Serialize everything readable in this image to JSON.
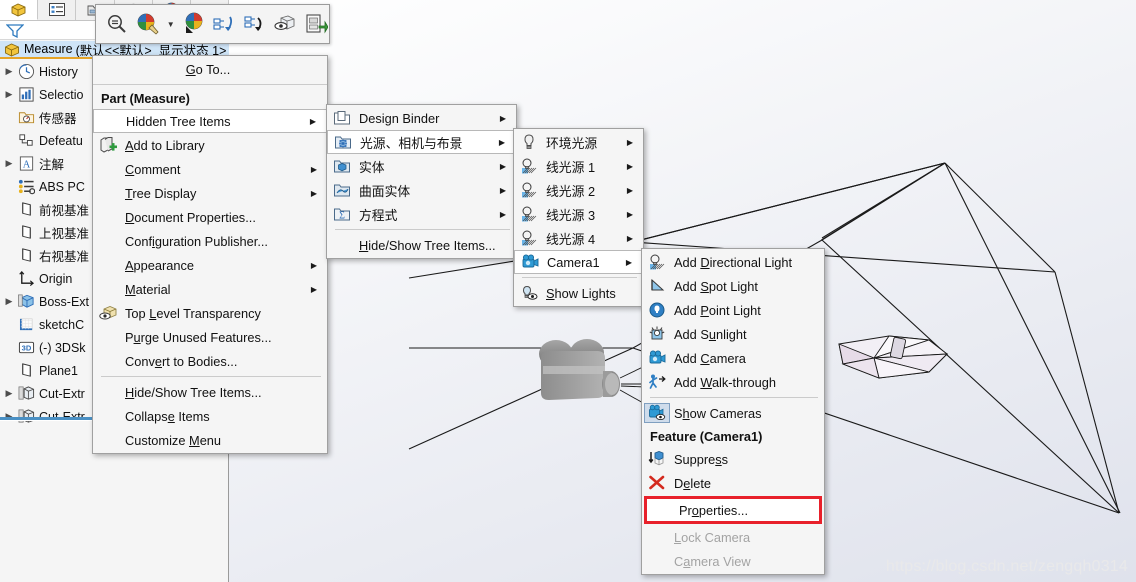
{
  "panel": {
    "tabs": [
      {
        "name": "feature-manager-tab",
        "icon": "yellow-box-icon"
      },
      {
        "name": "property-manager-tab",
        "icon": "list-icon"
      },
      {
        "name": "configuration-manager-tab",
        "icon": "config-icon"
      },
      {
        "name": "dimxpert-manager-tab",
        "icon": "globe-icon"
      },
      {
        "name": "display-manager-tab",
        "icon": "palette-icon"
      },
      {
        "name": "more-tab",
        "icon": "arrow-icon"
      }
    ],
    "filter_placeholder": "",
    "document": {
      "name": "Measure",
      "config": "(默认<<默认>_显示状态 1>"
    },
    "tree": [
      {
        "arrow": true,
        "icon": "history-icon",
        "label": "History"
      },
      {
        "arrow": true,
        "icon": "selection-sets-icon",
        "label": "Selectio"
      },
      {
        "arrow": false,
        "icon": "sensors-icon",
        "label": "传感器"
      },
      {
        "arrow": false,
        "icon": "defeature-icon",
        "label": "Defeatu"
      },
      {
        "arrow": true,
        "icon": "annotations-icon",
        "label": "注解"
      },
      {
        "arrow": false,
        "icon": "material-icon",
        "label": "ABS PC"
      },
      {
        "arrow": false,
        "icon": "plane-icon",
        "label": "前视基准"
      },
      {
        "arrow": false,
        "icon": "plane-icon",
        "label": "上视基准"
      },
      {
        "arrow": false,
        "icon": "plane-icon",
        "label": "右视基准"
      },
      {
        "arrow": false,
        "icon": "origin-icon",
        "label": "Origin"
      },
      {
        "arrow": true,
        "icon": "boss-extrude-icon",
        "label": "Boss-Ext"
      },
      {
        "arrow": false,
        "icon": "sketch-icon",
        "label": "sketchC"
      },
      {
        "arrow": false,
        "icon": "3dsketch-icon",
        "label": "(-) 3DSk"
      },
      {
        "arrow": false,
        "icon": "plane-icon",
        "label": "Plane1"
      },
      {
        "arrow": true,
        "icon": "cut-extrude-icon",
        "label": "Cut-Extr"
      },
      {
        "arrow": true,
        "icon": "cut-extrude-icon",
        "label": "Cut-Extr"
      }
    ]
  },
  "context_toolbar": {
    "buttons": [
      {
        "name": "zoom-to-selection-button",
        "icon": "magnifier-icon"
      },
      {
        "name": "appearance-button",
        "icon": "paint-sphere-icon"
      },
      {
        "name": "appearance-dropdown",
        "icon": "chevron-down-icon"
      },
      {
        "name": "change-transparency-button",
        "icon": "sphere-arrow-icon"
      },
      {
        "name": "rollback-button",
        "icon": "rollback-icon"
      },
      {
        "name": "parent-child-button",
        "icon": "parent-child-icon"
      },
      {
        "name": "hide-show-button",
        "icon": "eye-box-icon"
      },
      {
        "name": "open-document-button",
        "icon": "open-doc-icon"
      }
    ]
  },
  "menu_main": {
    "go_to": "Go To...",
    "header": "Part (Measure)",
    "items": [
      {
        "label": "Hidden Tree Items",
        "icon": null,
        "arrow": true,
        "highlighted": true
      },
      {
        "label": "Add to Library",
        "icon": "add-to-library-icon",
        "arrow": false,
        "underline": 0
      },
      {
        "label": "Comment",
        "icon": null,
        "arrow": true
      },
      {
        "label": "Tree Display",
        "icon": null,
        "arrow": true
      },
      {
        "label": "Document Properties...",
        "icon": null,
        "arrow": false
      },
      {
        "label": "Configuration Publisher...",
        "icon": null,
        "arrow": false
      },
      {
        "label": "Appearance",
        "icon": null,
        "arrow": true
      },
      {
        "label": "Material",
        "icon": null,
        "arrow": true
      },
      {
        "label": "Top Level Transparency",
        "icon": "transparency-icon",
        "arrow": false
      },
      {
        "label": "Purge Unused Features...",
        "icon": null,
        "arrow": false
      },
      {
        "label": "Convert to Bodies...",
        "icon": null,
        "arrow": false
      },
      {
        "separator": true
      },
      {
        "label": "Hide/Show Tree Items...",
        "icon": null,
        "arrow": false
      },
      {
        "label": "Collapse Items",
        "icon": null,
        "arrow": false
      },
      {
        "label": "Customize Menu",
        "icon": null,
        "arrow": false
      }
    ]
  },
  "menu_hidden_tree_items": {
    "items": [
      {
        "label": "Design Binder",
        "icon": "design-binder-icon",
        "arrow": true
      },
      {
        "label": "光源、相机与布景",
        "icon": "lights-folder-icon",
        "arrow": true,
        "highlighted": true
      },
      {
        "label": "实体",
        "icon": "solid-bodies-icon",
        "arrow": true
      },
      {
        "label": "曲面实体",
        "icon": "surface-bodies-icon",
        "arrow": true
      },
      {
        "label": "方程式",
        "icon": "equations-icon",
        "arrow": true
      },
      {
        "separator": true
      },
      {
        "label": "Hide/Show Tree Items...",
        "icon": null,
        "arrow": false
      }
    ]
  },
  "menu_lights": {
    "items": [
      {
        "label": "环境光源",
        "icon": "ambient-light-icon",
        "arrow": true
      },
      {
        "label": "线光源 1",
        "icon": "directional-light-icon",
        "arrow": true
      },
      {
        "label": "线光源 2",
        "icon": "directional-light-icon",
        "arrow": true
      },
      {
        "label": "线光源 3",
        "icon": "directional-light-icon",
        "arrow": true
      },
      {
        "label": "线光源 4",
        "icon": "directional-light-icon",
        "arrow": true
      },
      {
        "label": "Camera1",
        "icon": "camera-icon",
        "arrow": true,
        "highlighted": true
      },
      {
        "separator": true
      },
      {
        "label": "Show Lights",
        "icon": "show-lights-icon",
        "arrow": false
      }
    ]
  },
  "menu_camera": {
    "header": "Feature (Camera1)",
    "items_top": [
      {
        "label": "Add Directional Light",
        "icon": "directional-light-icon"
      },
      {
        "label": "Add Spot Light",
        "icon": "spot-light-icon"
      },
      {
        "label": "Add Point Light",
        "icon": "point-light-icon"
      },
      {
        "label": "Add Sunlight",
        "icon": "sunlight-icon"
      },
      {
        "label": "Add Camera",
        "icon": "camera-icon"
      },
      {
        "label": "Add Walk-through",
        "icon": "walk-through-icon"
      },
      {
        "label": "Show Cameras",
        "icon": "show-cameras-icon",
        "toggled": true
      }
    ],
    "items_bottom": [
      {
        "label": "Suppress",
        "icon": "suppress-icon",
        "disabled": false
      },
      {
        "label": "Delete",
        "icon": "delete-icon",
        "disabled": false
      },
      {
        "label": "Properties...",
        "icon": null,
        "disabled": false,
        "highlighted_red": true
      },
      {
        "label": "Lock Camera",
        "icon": null,
        "disabled": true
      },
      {
        "label": "Camera View",
        "icon": null,
        "disabled": true
      }
    ]
  },
  "viewport": {
    "watermark": "https://blog.csdn.net/zengqh0314",
    "camera_model": "camera-3d-model",
    "accent_red": "#e8212b",
    "accent_orange": "#e6a427",
    "highlight_blue": "#cfe4f7"
  }
}
